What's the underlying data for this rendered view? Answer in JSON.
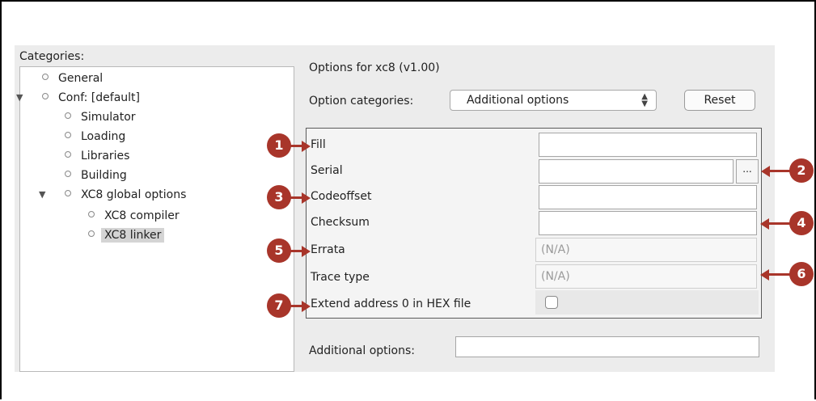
{
  "sidebar": {
    "title": "Categories:",
    "items": [
      {
        "label": "General"
      },
      {
        "label": "Conf: [default]",
        "expanded": true
      },
      {
        "label": "Simulator"
      },
      {
        "label": "Loading"
      },
      {
        "label": "Libraries"
      },
      {
        "label": "Building"
      },
      {
        "label": "XC8 global options",
        "expanded": true
      },
      {
        "label": "XC8 compiler"
      },
      {
        "label": "XC8 linker",
        "selected": true
      }
    ]
  },
  "main": {
    "title": "Options for xc8 (v1.00)",
    "option_categories_label": "Option categories:",
    "option_categories_value": "Additional options",
    "reset_label": "Reset",
    "rows": [
      {
        "label": "Fill",
        "value": ""
      },
      {
        "label": "Serial",
        "value": "",
        "browse": "..."
      },
      {
        "label": "Codeoffset",
        "value": ""
      },
      {
        "label": "Checksum",
        "value": ""
      },
      {
        "label": "Errata",
        "value": "(N/A)"
      },
      {
        "label": "Trace type",
        "value": "(N/A)"
      },
      {
        "label": "Extend address 0 in HEX file",
        "checked": false
      }
    ],
    "additional_options_label": "Additional options:",
    "additional_options_value": ""
  },
  "callouts": [
    "1",
    "2",
    "3",
    "4",
    "5",
    "6",
    "7"
  ],
  "colors": {
    "callout": "#a8352a",
    "selection": "#d4d4d4"
  }
}
